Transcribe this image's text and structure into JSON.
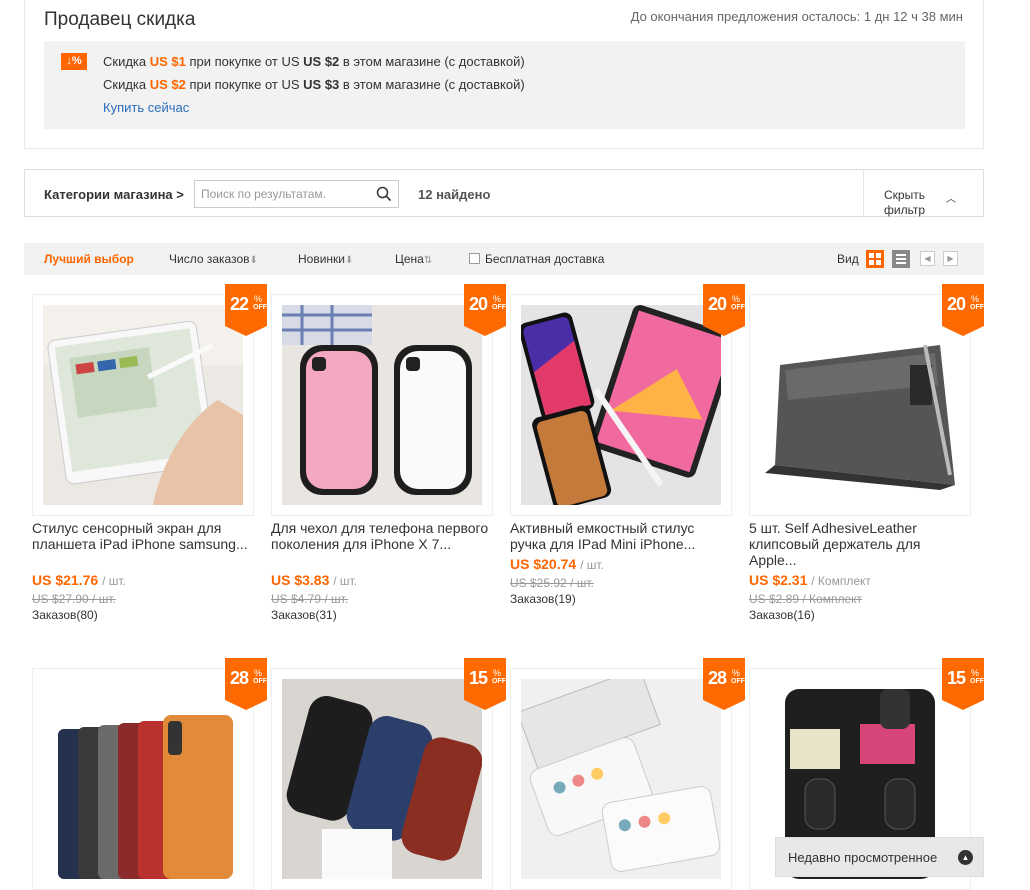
{
  "promo": {
    "title": "Продавец скидка",
    "timer": "До окончания предложения осталось: 1 дн 12 ч 38 мин",
    "badge": "↓%",
    "lines": [
      {
        "a": "Скидка ",
        "amount": "US $1",
        "b": " при покупке от US ",
        "threshold": "US $2",
        "c": " в этом магазине (с доставкой)"
      },
      {
        "a": "Скидка ",
        "amount": "US $2",
        "b": " при покупке от US ",
        "threshold": "US $3",
        "c": " в этом магазине (с доставкой)"
      }
    ],
    "buy_now": "Купить сейчас"
  },
  "filter": {
    "categories_label": "Категории магазина >",
    "search_placeholder": "Поиск по результатам.",
    "found": "12 найдено",
    "hide_filter": "Скрыть фильтр"
  },
  "sort": {
    "best": "Лучший выбор",
    "orders": "Число заказов",
    "newest": "Новинки",
    "price": "Цена",
    "free_shipping": "Бесплатная доставка",
    "view_label": "Вид"
  },
  "colors": {
    "accent": "#ff6600",
    "link": "#2a6ebb"
  },
  "products": [
    {
      "discount": "22",
      "title": "Стилус сенсорный экран для планшета iPad iPhone samsung...",
      "price": "US $21.76",
      "unit": "/ шт.",
      "old_price": "US $27.90 / шт.",
      "orders": "Заказов(80)"
    },
    {
      "discount": "20",
      "title": "Для чехол для телефона первого поколения для iPhone X 7...",
      "price": "US $3.83",
      "unit": "/ шт.",
      "old_price": "US $4.79 / шт.",
      "orders": "Заказов(31)"
    },
    {
      "discount": "20",
      "title": "Активный емкостный стилус ручка для IPad Mini iPhone...",
      "price": "US $20.74",
      "unit": "/ шт.",
      "old_price": "US $25.92 / шт.",
      "orders": "Заказов(19)"
    },
    {
      "discount": "20",
      "title": "5 шт. Self AdhesiveLeather клипсовый держатель для Apple...",
      "price": "US $2.31",
      "unit": "/ Комплект",
      "old_price": "US $2.89 / Комплект",
      "orders": "Заказов(16)"
    },
    {
      "discount": "28"
    },
    {
      "discount": "15"
    },
    {
      "discount": "28"
    },
    {
      "discount": "15"
    }
  ],
  "off_label": "OFF",
  "pct_label": "%",
  "recently_viewed": "Недавно просмотренное"
}
